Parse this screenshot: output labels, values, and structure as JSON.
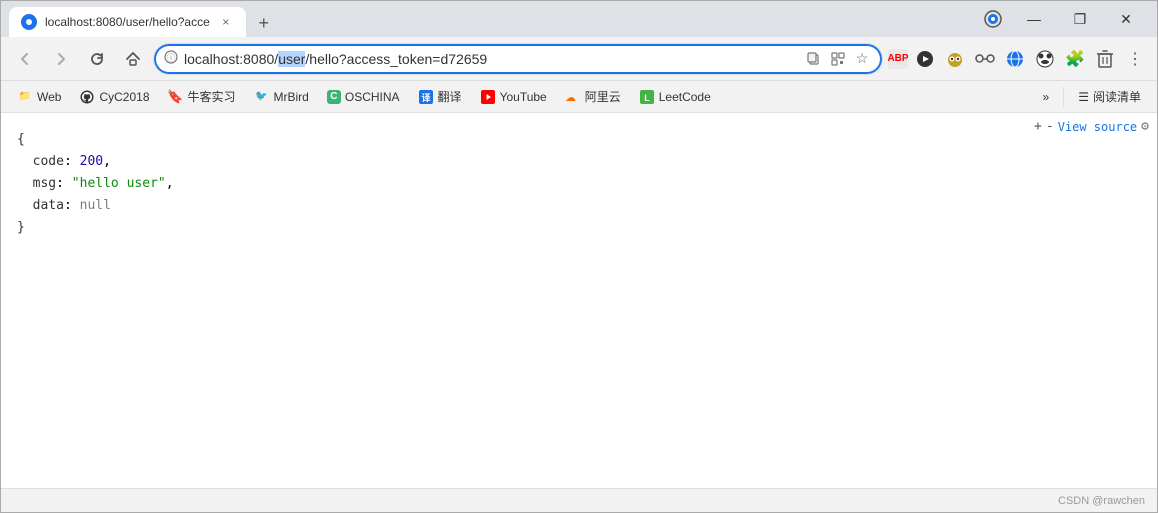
{
  "titlebar": {
    "tab": {
      "title": "localhost:8080/user/hello?acce",
      "close_label": "×"
    },
    "new_tab_label": "+",
    "controls": {
      "minimize": "—",
      "maximize": "❐",
      "close": "✕"
    }
  },
  "navbar": {
    "back_label": "←",
    "forward_label": "→",
    "reload_label": "↻",
    "home_label": "⌂",
    "address": {
      "prefix": "localhost:8080/",
      "highlight": "user",
      "suffix": "/hello?access_token=d72659",
      "full": "localhost:8080/user/hello?access_token=d72659"
    },
    "star_label": "☆",
    "grid_label": "⊞",
    "dropdown_label": "⌄",
    "extensions": {
      "abp": "ABP",
      "play": "▶",
      "owl": "🦉",
      "mask": "👓",
      "orb": "🌐",
      "panda": "🐼",
      "puzzle": "🧩",
      "trash": "🗑",
      "more": "⋮"
    }
  },
  "bookmarks": {
    "items": [
      {
        "id": "web",
        "icon": "📁",
        "icon_color": "#f5c518",
        "label": "Web"
      },
      {
        "id": "github",
        "icon": "⚫",
        "icon_color": "#333",
        "label": "CyC2018"
      },
      {
        "id": "niuke",
        "icon": "🔖",
        "icon_color": "#e8343c",
        "label": "牛客实习"
      },
      {
        "id": "mrbird",
        "icon": "🐦",
        "icon_color": "#f5c518",
        "label": "MrBird"
      },
      {
        "id": "oschina",
        "icon": "C",
        "icon_color": "#3cb371",
        "label": "OSCHINA"
      },
      {
        "id": "fanyi",
        "icon": "译",
        "icon_color": "#1a73e8",
        "label": "翻译"
      },
      {
        "id": "youtube",
        "icon": "▶",
        "icon_color": "#ff0000",
        "label": "YouTube"
      },
      {
        "id": "aliyun",
        "icon": "☁",
        "icon_color": "#ff6a00",
        "label": "阿里云"
      },
      {
        "id": "leetcode",
        "icon": "L",
        "icon_color": "#44b341",
        "label": "LeetCode"
      }
    ],
    "more_label": "»",
    "reading_mode_label": "阅读清单",
    "reading_mode_icon": "☰"
  },
  "content": {
    "line1": "{",
    "line2_key": "code",
    "line2_value": "200",
    "line3_key": "msg",
    "line3_value": "\"hello user\"",
    "line4_key": "data",
    "line4_value": "null",
    "line5": "}"
  },
  "view_source": {
    "plus": "+",
    "minus": "-",
    "link_label": "View source",
    "gear_label": "⚙"
  },
  "statusbar": {
    "text": "CSDN @rawchen"
  }
}
